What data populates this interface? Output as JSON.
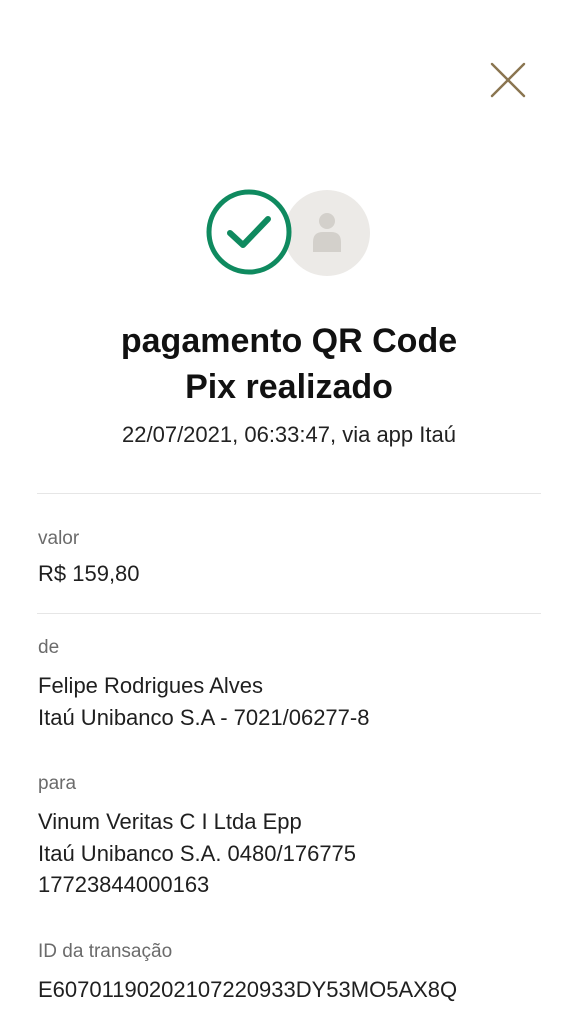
{
  "header": {
    "close_icon": "close-icon",
    "close_color": "#8a7550"
  },
  "status": {
    "success_icon": "check-circle-icon",
    "success_color": "#0f8a5f",
    "avatar_icon": "person-placeholder-icon",
    "title_line1": "pagamento QR Code",
    "title_line2": "Pix realizado",
    "subtitle": "22/07/2021, 06:33:47, via app Itaú"
  },
  "details": {
    "valor": {
      "label": "valor",
      "value": "R$ 159,80"
    },
    "de": {
      "label": "de",
      "name": "Felipe Rodrigues Alves",
      "bank": "Itaú Unibanco S.A - 7021/06277-8"
    },
    "para": {
      "label": "para",
      "name": "Vinum Veritas C I Ltda Epp",
      "bank": "Itaú Unibanco S.A. 0480/176775",
      "document": "17723844000163"
    },
    "transacao": {
      "label": "ID da transação",
      "id": "E60701190202107220933DY53MO5AX8Q"
    }
  }
}
